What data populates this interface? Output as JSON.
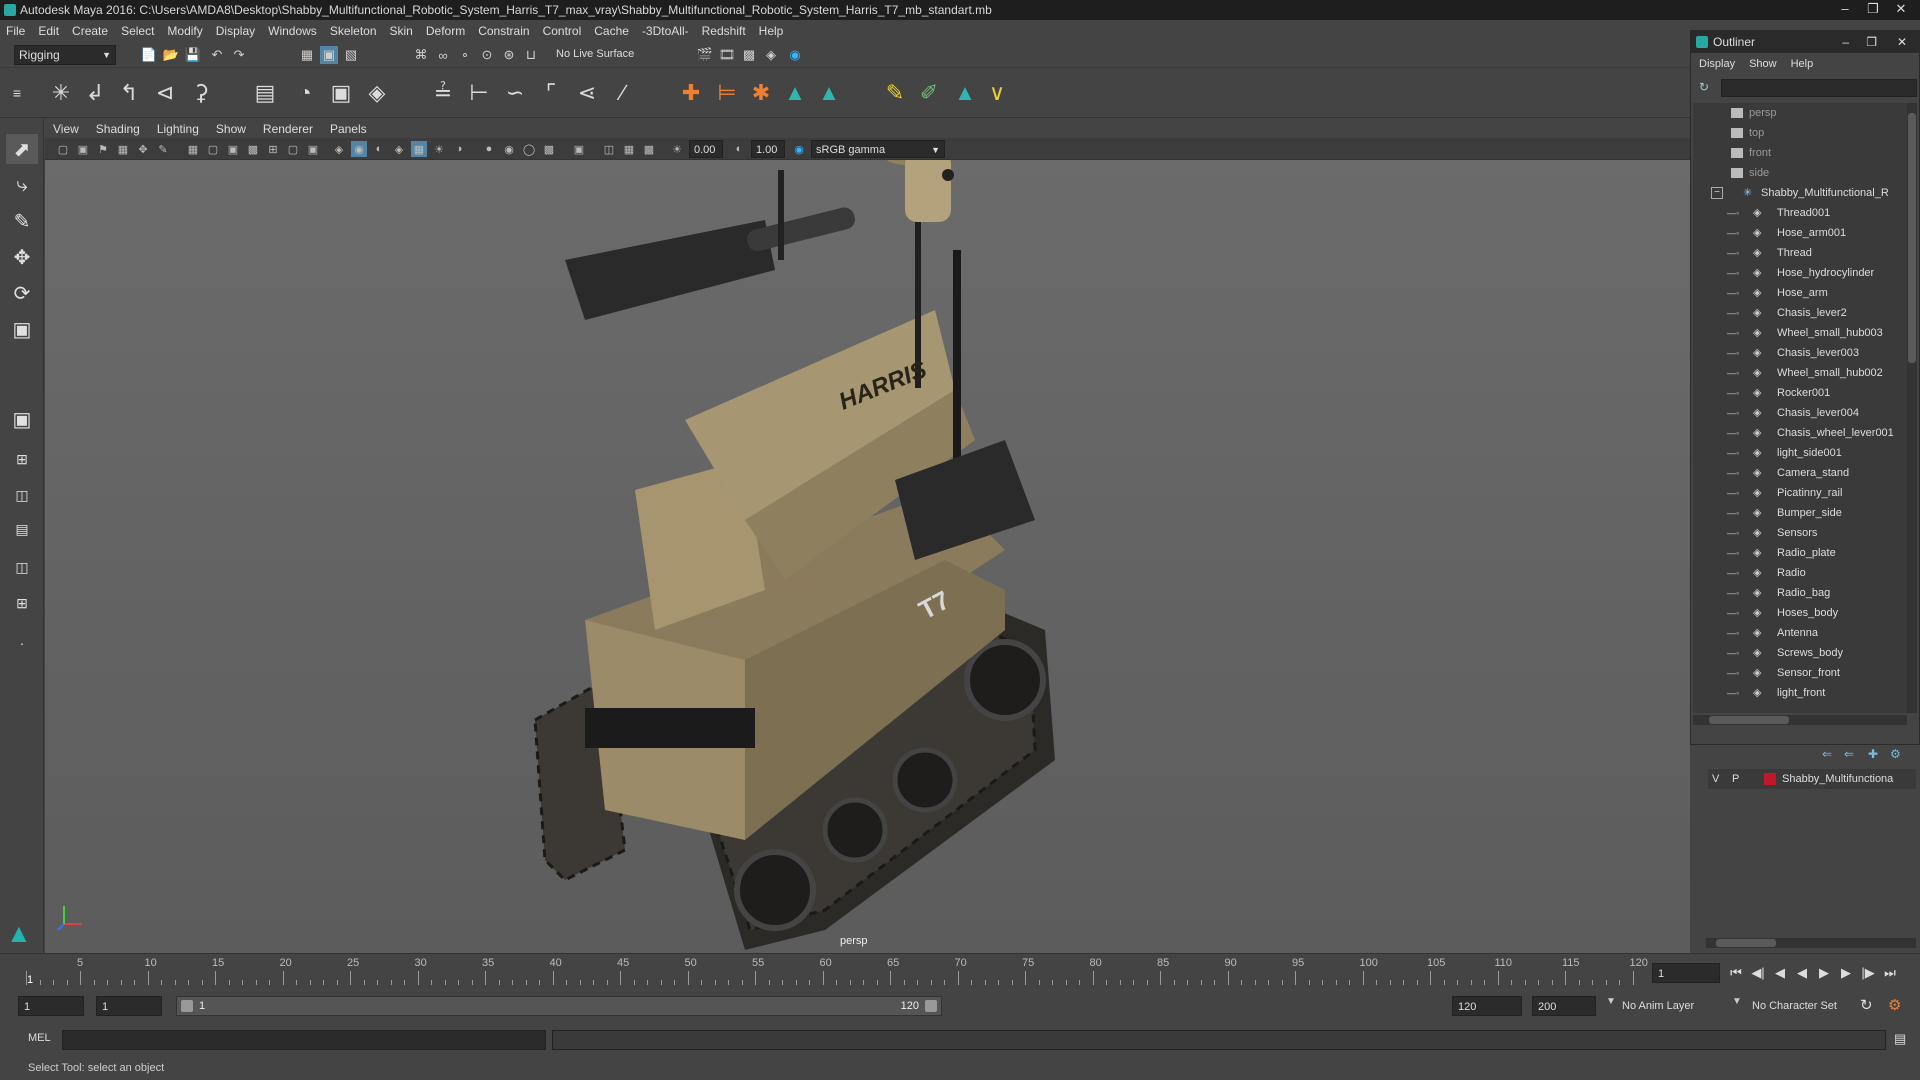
{
  "window": {
    "title": "Autodesk Maya 2016: C:\\Users\\AMDA8\\Desktop\\Shabby_Multifunctional_Robotic_System_Harris_T7_max_vray\\Shabby_Multifunctional_Robotic_System_Harris_T7_mb_standart.mb"
  },
  "menubar": [
    "File",
    "Edit",
    "Create",
    "Select",
    "Modify",
    "Display",
    "Windows",
    "Skeleton",
    "Skin",
    "Deform",
    "Constrain",
    "Control",
    "Cache",
    "-3DtoAll-",
    "Redshift",
    "Help"
  ],
  "status": {
    "mode": "Rigging",
    "live_surface": "No Live Surface"
  },
  "viewport": {
    "menu": [
      "View",
      "Shading",
      "Lighting",
      "Show",
      "Renderer",
      "Panels"
    ],
    "exposure": "0.00",
    "gamma": "1.00",
    "color_space": "sRGB gamma",
    "camera_label": "persp",
    "model_text": {
      "brand": "HARRIS",
      "model": "T7"
    }
  },
  "outliner": {
    "title": "Outliner",
    "menu": [
      "Display",
      "Show",
      "Help"
    ],
    "cameras": [
      "persp",
      "top",
      "front",
      "side"
    ],
    "root": "Shabby_Multifunctional_R",
    "children": [
      "Thread001",
      "Hose_arm001",
      "Thread",
      "Hose_hydrocylinder",
      "Hose_arm",
      "Chasis_lever2",
      "Wheel_small_hub003",
      "Chasis_lever003",
      "Wheel_small_hub002",
      "Rocker001",
      "Chasis_lever004",
      "Chasis_wheel_lever001",
      "light_side001",
      "Camera_stand",
      "Picatinny_rail",
      "Bumper_side",
      "Sensors",
      "Radio_plate",
      "Radio",
      "Radio_bag",
      "Hoses_body",
      "Antenna",
      "Screws_body",
      "Sensor_front",
      "light_front"
    ]
  },
  "layers": {
    "v": "V",
    "p": "P",
    "name": "Shabby_Multifunctiona",
    "color": "#c0182a"
  },
  "timeline": {
    "labels": [
      "5",
      "10",
      "15",
      "20",
      "25",
      "30",
      "35",
      "40",
      "45",
      "50",
      "55",
      "60",
      "65",
      "70",
      "75",
      "80",
      "85",
      "90",
      "95",
      "100",
      "105",
      "110",
      "115",
      "120"
    ],
    "start_marker": "1",
    "current_frame": "1"
  },
  "range": {
    "start": "1",
    "playback_start": "1",
    "slider_start": "1",
    "slider_end": "120",
    "playback_end": "120",
    "end": "200",
    "anim_layer": "No Anim Layer",
    "character_set": "No Character Set"
  },
  "command": {
    "lang": "MEL"
  },
  "help": {
    "text": "Select Tool: select an object"
  }
}
